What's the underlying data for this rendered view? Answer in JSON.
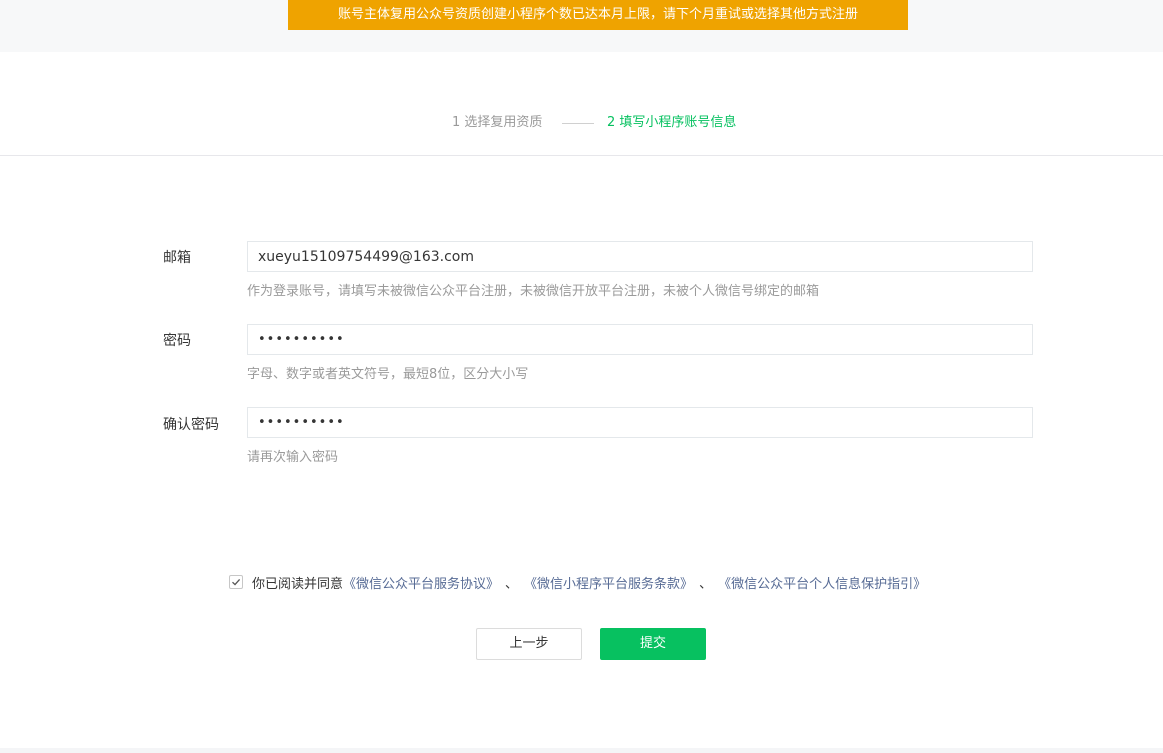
{
  "banner": {
    "text": "账号主体复用公众号资质创建小程序个数已达本月上限，请下个月重试或选择其他方式注册",
    "color": "#efa300"
  },
  "steps": [
    {
      "label": "1 选择复用资质",
      "active": false
    },
    {
      "label": "2 填写小程序账号信息",
      "active": true
    }
  ],
  "form": {
    "email": {
      "label": "邮箱",
      "value": "xueyu15109754499@163.com",
      "tip": "作为登录账号，请填写未被微信公众平台注册，未被微信开放平台注册，未被个人微信号绑定的邮箱"
    },
    "password": {
      "label": "密码",
      "value": "••••••••••",
      "tip": "字母、数字或者英文符号，最短8位，区分大小写"
    },
    "confirm": {
      "label": "确认密码",
      "value": "••••••••••",
      "tip": "请再次输入密码"
    }
  },
  "agreement": {
    "checked": true,
    "prefix": "你已阅读并同意",
    "links": [
      "《微信公众平台服务协议》",
      "《微信小程序平台服务条款》",
      "《微信公众平台个人信息保护指引》"
    ],
    "separator": "、"
  },
  "buttons": {
    "prev": "上一步",
    "submit": "提交"
  },
  "colors": {
    "accent": "#07c160",
    "link": "#576b95"
  }
}
